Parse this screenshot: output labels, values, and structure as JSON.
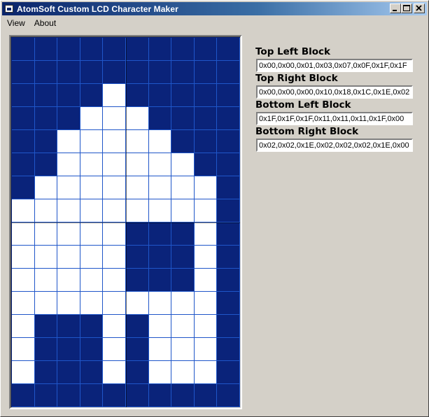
{
  "window": {
    "title": "AtomSoft Custom LCD Character Maker",
    "controls": [
      "minimize",
      "maximize",
      "close"
    ]
  },
  "menu": [
    "View",
    "About"
  ],
  "grid": {
    "columns": 10,
    "rows": 16,
    "on_color": "#ffffff",
    "off_color": "#0a237a",
    "line_color": "#1f56c9",
    "pixels": [
      "0000000000",
      "0000000000",
      "0000100000",
      "0001110000",
      "0011111000",
      "0011111100",
      "0111111110",
      "1111111110",
      "1111100010",
      "1111100010",
      "1111100010",
      "1111111110",
      "1000101110",
      "1000101110",
      "1000101110",
      "0000000000"
    ]
  },
  "blocks": [
    {
      "label": "Top Left Block",
      "value": "0x00,0x00,0x01,0x03,0x07,0x0F,0x1F,0x1F"
    },
    {
      "label": "Top Right Block",
      "value": "0x00,0x00,0x00,0x10,0x18,0x1C,0x1E,0x02"
    },
    {
      "label": "Bottom Left Block",
      "value": "0x1F,0x1F,0x1F,0x11,0x11,0x11,0x1F,0x00"
    },
    {
      "label": "Bottom Right Block",
      "value": "0x02,0x02,0x1E,0x02,0x02,0x02,0x1E,0x00"
    }
  ]
}
